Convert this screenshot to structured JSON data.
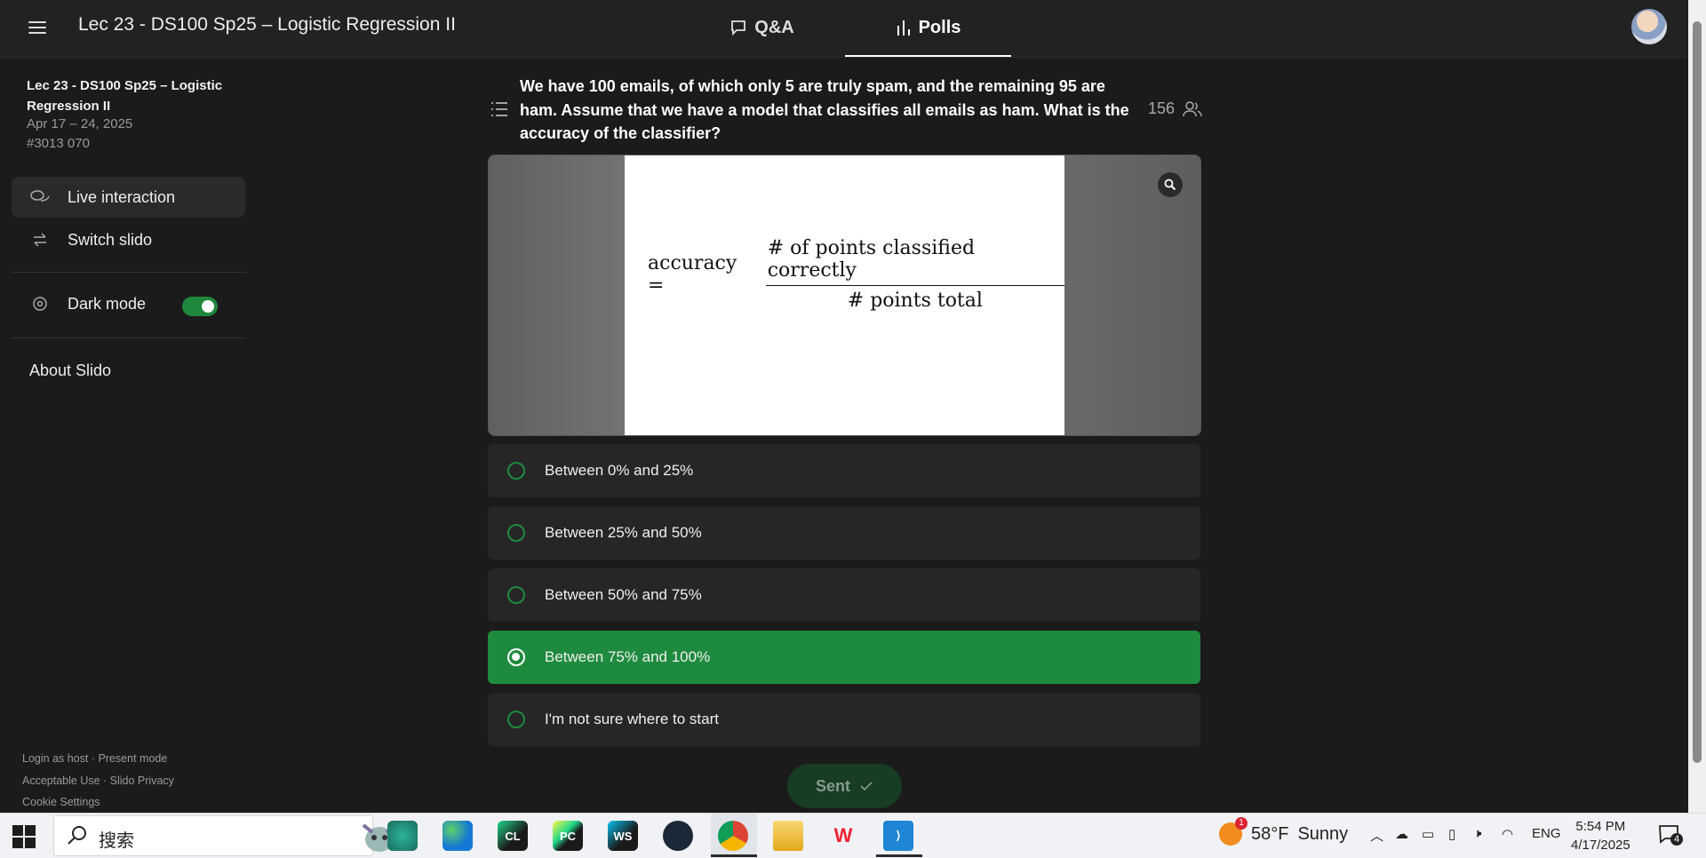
{
  "header": {
    "event_title": "Lec 23 - DS100 Sp25 – Logistic Regression II",
    "tabs": [
      {
        "label": "Q&A",
        "icon": "chat-bubble-icon"
      },
      {
        "label": "Polls",
        "icon": "bar-chart-icon"
      }
    ],
    "active_tab": "Polls"
  },
  "sidebar": {
    "event_title": "Lec 23 - DS100 Sp25 – Logistic Regression II",
    "dates": "Apr 17 – 24, 2025",
    "code": "#3013 070",
    "items": [
      {
        "label": "Live interaction",
        "icon": "chat-bubbles-icon",
        "active": true
      },
      {
        "label": "Switch slido",
        "icon": "swap-arrows-icon",
        "active": false
      }
    ],
    "dark_mode_label": "Dark mode",
    "dark_mode_on": true,
    "about_label": "About Slido",
    "footer": {
      "line1": "Login as host · Present mode",
      "line2": "Acceptable Use · Slido Privacy",
      "line3": "Cookie Settings"
    }
  },
  "poll": {
    "question": "We have 100 emails, of which only 5 are truly spam, and the remaining 95 are ham. Assume that we have a model that classifies all emails as ham. What is the accuracy of the classifier?",
    "participants": "156",
    "formula": {
      "lhs": "accuracy =",
      "numerator": "# of points classified correctly",
      "denominator": "# points total"
    },
    "options": [
      {
        "label": "Between 0% and 25%",
        "selected": false
      },
      {
        "label": "Between 25% and 50%",
        "selected": false
      },
      {
        "label": "Between 50% and 75%",
        "selected": false
      },
      {
        "label": "Between 75% and 100%",
        "selected": true
      },
      {
        "label": "I'm not sure where to start",
        "selected": false
      }
    ],
    "submit_label": "Sent",
    "accent_color": "#1e8a3d"
  },
  "taskbar": {
    "search_placeholder": "搜索",
    "weather": {
      "temp": "58°F",
      "condition": "Sunny",
      "badge": "1"
    },
    "lang": "ENG",
    "time": "5:54 PM",
    "date": "4/17/2025",
    "notification_count": "4",
    "apps": [
      "brain-app-icon",
      "edge-icon",
      "clion-icon",
      "pycharm-icon",
      "webstorm-icon",
      "steam-icon",
      "chrome-icon",
      "file-explorer-icon",
      "wps-icon",
      "vscode-icon"
    ]
  }
}
